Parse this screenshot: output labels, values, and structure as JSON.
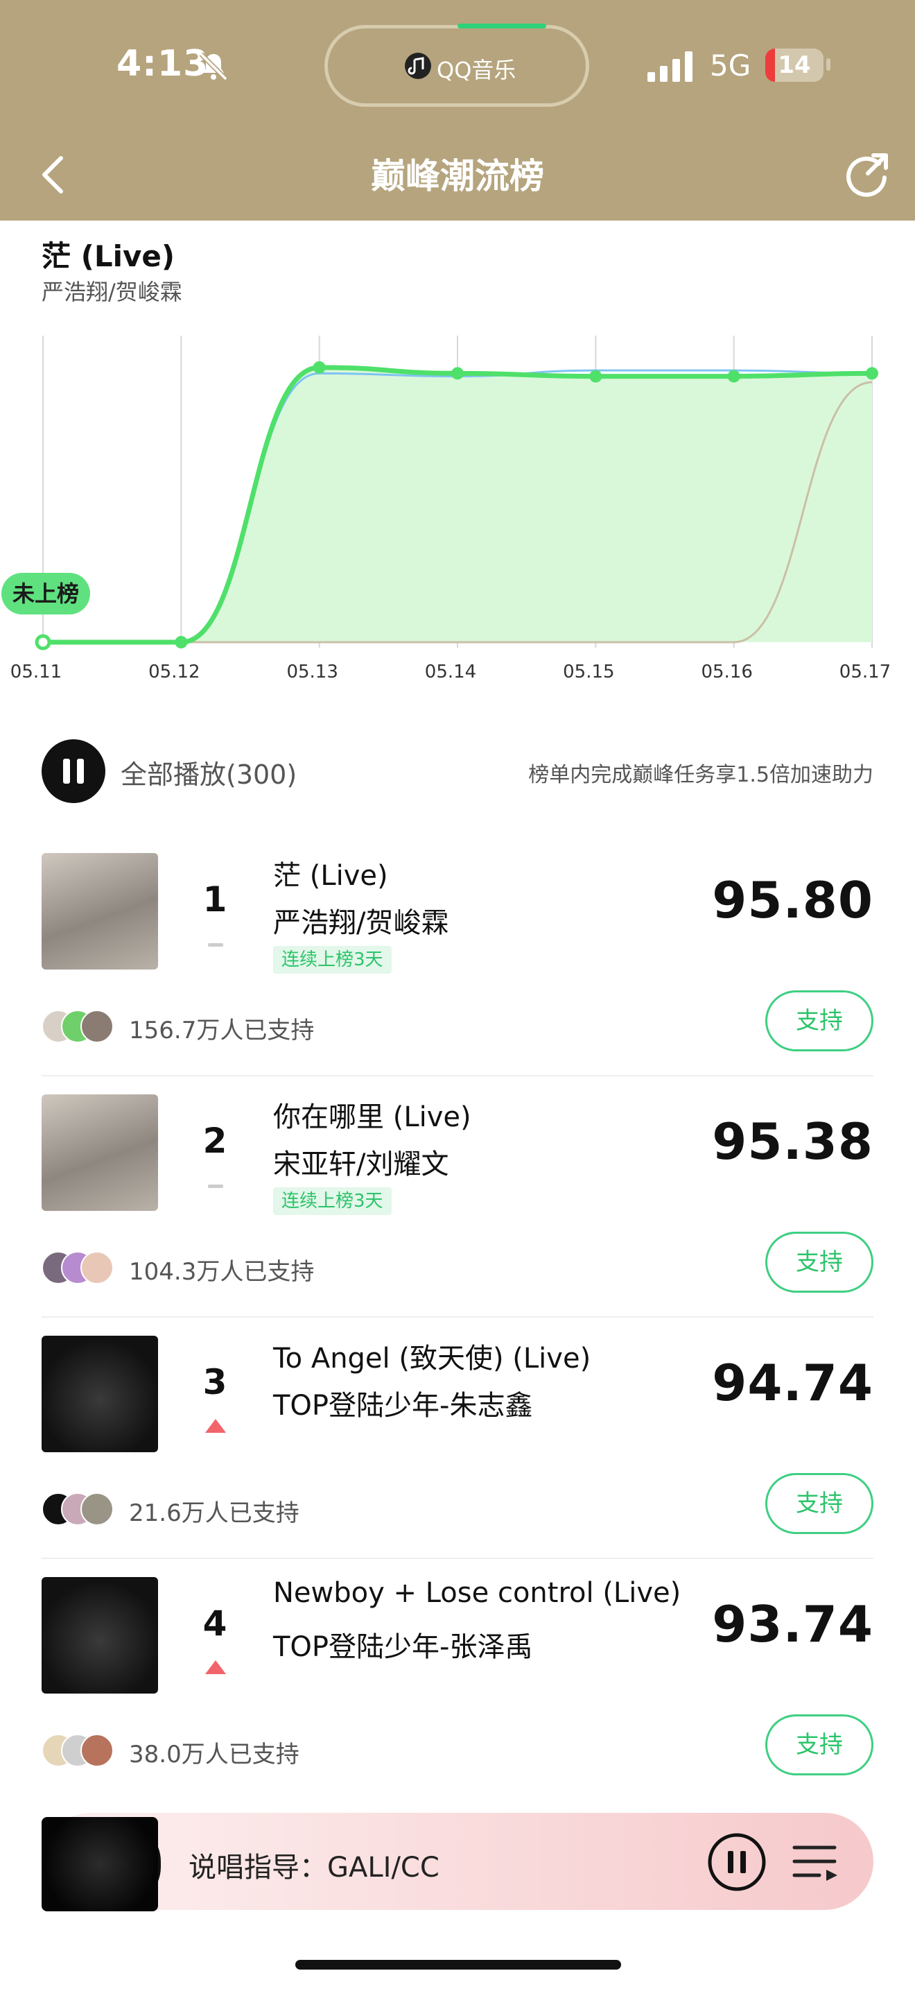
{
  "status_bar": {
    "time": "4:13",
    "app_badge": "QQ音乐",
    "network": "5G",
    "battery": "14"
  },
  "header": {
    "title": "巅峰潮流榜"
  },
  "chart": {
    "song_title": "茫 (Live)",
    "song_artist": "严浩翔/贺峻霖",
    "not_ranked_label": "未上榜",
    "accent_color": "#4fe06a"
  },
  "chart_data": {
    "type": "line",
    "title": "",
    "x": [
      "05.11",
      "05.12",
      "05.13",
      "05.14",
      "05.15",
      "05.16",
      "05.17"
    ],
    "series": [
      {
        "values": [
          0.0,
          0.0,
          0.93,
          0.91,
          0.9,
          0.9,
          0.91
        ]
      },
      {
        "values": [
          0.0,
          0.0,
          0.91,
          0.9,
          0.92,
          0.92,
          0.91
        ]
      },
      {
        "values": [
          0.0,
          0.0,
          0.0,
          0.0,
          0.0,
          0.0,
          0.88
        ]
      }
    ],
    "grid": true
  },
  "play_all": {
    "label": "全部播放(300)",
    "note": "榜单内完成巅峰任务享1.5倍加速助力"
  },
  "tracks": [
    {
      "rank": "1",
      "title": "茫 (Live)",
      "artist": "严浩翔/贺峻霖",
      "streak": "连续上榜3天",
      "score": "95.80",
      "supporters": "156.7万人已支持",
      "support_label": "支持",
      "trend": "same"
    },
    {
      "rank": "2",
      "title": "你在哪里 (Live)",
      "artist": "宋亚轩/刘耀文",
      "streak": "连续上榜3天",
      "score": "95.38",
      "supporters": "104.3万人已支持",
      "support_label": "支持",
      "trend": "same"
    },
    {
      "rank": "3",
      "title": "To Angel (致天使) (Live)",
      "artist": "TOP登陆少年-朱志鑫",
      "score": "94.74",
      "supporters": "21.6万人已支持",
      "support_label": "支持",
      "trend": "up"
    },
    {
      "rank": "4",
      "title": "Newboy + Lose control (Live)",
      "artist": "TOP登陆少年-张泽禹",
      "score": "93.74",
      "supporters": "38.0万人已支持",
      "support_label": "支持",
      "trend": "up"
    }
  ],
  "mini_player": {
    "lyric": "说唱指导：GALI/CC"
  }
}
